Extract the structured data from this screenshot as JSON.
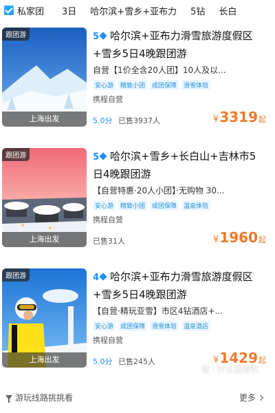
{
  "filter_bar": {
    "items": [
      "私家团",
      "3日",
      "哈尔滨+雪乡+亚布力",
      "5钻",
      "长白"
    ]
  },
  "products": [
    {
      "badge": "跟团游",
      "departure": "上海出发",
      "diamond": "5",
      "title": "哈尔滨+亚布力滑雪旅游度假区+雪乡5日4晚跟团游",
      "subtitle": "自营【1价全含20人团】10人及以...",
      "tags": [
        "安心游",
        "精致小团",
        "成团保障",
        "滑雪体验"
      ],
      "vendor": "携程自营",
      "score": "5.0分",
      "sold": "已售3937人",
      "price_symbol": "¥",
      "price": "3319",
      "price_suffix": "起"
    },
    {
      "badge": "跟团游",
      "departure": "上海出发",
      "diamond": "5",
      "title": "哈尔滨+雪乡+长白山+吉林市5日4晚跟团游",
      "subtitle": "【自营特惠·20人小团】·无购物 30...",
      "tags": [
        "安心游",
        "精致小团",
        "成团保障",
        "温泉体验"
      ],
      "vendor": "携程自营",
      "score": "",
      "sold": "已售31人",
      "price_symbol": "¥",
      "price": "1960",
      "price_suffix": "起"
    },
    {
      "badge": "跟团游",
      "departure": "上海出发",
      "diamond": "4",
      "title": "哈尔滨+亚布力滑雪旅游度假区+雪乡5日4晚跟团游",
      "subtitle": "【自营·精玩亚雪】市区4钻酒店+...",
      "tags": [
        "安心游",
        "成团保障",
        "滑雪体验",
        "温泉酒店"
      ],
      "vendor": "携程自营",
      "score": "5.0分",
      "sold": "已售245人",
      "price_symbol": "¥",
      "price": "1429",
      "price_suffix": "起"
    }
  ],
  "footer": {
    "left": "游玩线路挑挑看",
    "right": "更多"
  },
  "watermark": "值 · 什么值得买",
  "colors": {
    "accent_blue": "#1e8fff",
    "price_orange": "#f07a28",
    "tag_bg": "#eef7ff"
  }
}
